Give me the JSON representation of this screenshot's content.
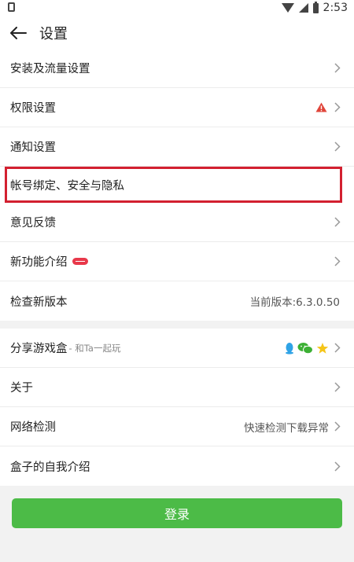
{
  "status_bar": {
    "time": "2:53"
  },
  "header": {
    "title": "设置"
  },
  "group1": {
    "items": [
      {
        "label": "安装及流量设置"
      },
      {
        "label": "权限设置"
      },
      {
        "label": "通知设置"
      },
      {
        "label": "帐号绑定、安全与隐私"
      },
      {
        "label": "意见反馈"
      },
      {
        "label": "新功能介绍"
      },
      {
        "label": "检查新版本",
        "value": "当前版本:6.3.0.50"
      }
    ]
  },
  "group2": {
    "items": [
      {
        "label": "分享游戏盒",
        "sub": "- 和Ta一起玩"
      },
      {
        "label": "关于"
      },
      {
        "label": "网络检测",
        "value": "快速检测下载异常"
      },
      {
        "label": "盒子的自我介绍"
      }
    ]
  },
  "login": {
    "label": "登录"
  },
  "colors": {
    "accent": "#4cbb47",
    "highlight": "#d32030",
    "badge": "#e8384a"
  },
  "icons": [
    "back-arrow-icon",
    "warning-icon",
    "chevron-right-icon",
    "qq-icon",
    "wechat-icon",
    "star-icon"
  ]
}
